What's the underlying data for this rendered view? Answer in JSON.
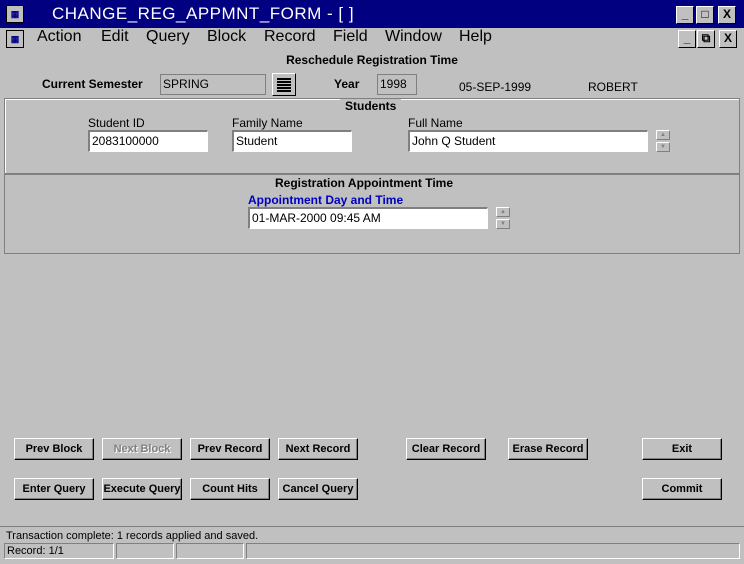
{
  "window": {
    "title": "CHANGE_REG_APPMNT_FORM - [ ]",
    "min_label": "_",
    "max_label": "□",
    "close_label": "X",
    "restore_label": "⧉"
  },
  "menu": [
    "Action",
    "Edit",
    "Query",
    "Block",
    "Record",
    "Field",
    "Window",
    "Help"
  ],
  "header": {
    "title": "Reschedule Registration Time",
    "semester_label": "Current Semester",
    "semester_value": "SPRING",
    "year_label": "Year",
    "year_value": "1998",
    "date": "05-SEP-1999",
    "user": "ROBERT"
  },
  "students": {
    "title": "Students",
    "student_id_label": "Student ID",
    "student_id_value": "2083100000",
    "family_name_label": "Family Name",
    "family_name_value": "Student",
    "full_name_label": "Full Name",
    "full_name_value": "John Q Student"
  },
  "appointment": {
    "title": "Registration Appointment Time",
    "day_time_label": "Appointment Day and Time",
    "day_time_value": "01-MAR-2000 09:45 AM"
  },
  "buttons": {
    "prev_block": "Prev Block",
    "next_block": "Next Block",
    "prev_record": "Prev Record",
    "next_record": "Next Record",
    "clear_record": "Clear Record",
    "erase_record": "Erase Record",
    "exit": "Exit",
    "enter_query": "Enter Query",
    "execute_query": "Execute Query",
    "count_hits": "Count Hits",
    "cancel_query": "Cancel Query",
    "commit": "Commit"
  },
  "status": {
    "message": "Transaction complete: 1 records applied and saved.",
    "record": "Record: 1/1"
  },
  "colors": {
    "titlebar": "#000080",
    "background": "#c0c0c0",
    "field_label_blue": "#0000c0"
  }
}
